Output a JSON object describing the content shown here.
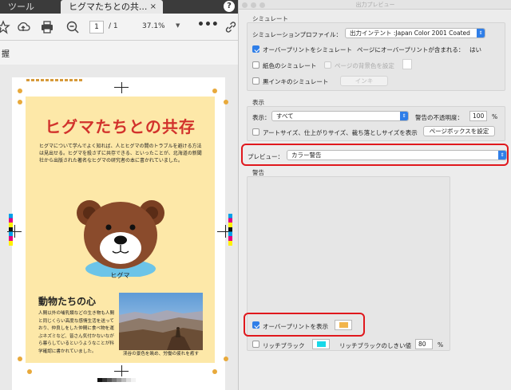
{
  "app": {
    "tools_tab": "ツール",
    "doc_tab": "ヒグマたちとの共...",
    "close_glyph": "×",
    "help_glyph": "?",
    "page_current": "1",
    "page_total": "/ 1",
    "zoom": "37.1%",
    "more_glyph": "•••",
    "subbar_text": "握"
  },
  "document": {
    "title": "ヒグマたちとの共存",
    "intro": "ヒグマについて学んでよく知れば、人とヒグマの間のトラブルを避ける方法は見出せる。ヒグマを殺さずに共存できる、といったことが、北海道の新聞社から出版された著名なヒグマの研究者の本に書かれていました。",
    "bear_caption": "ヒグマ",
    "animals_heading": "動物たちの心",
    "animals_body": "人間以外の哺乳類などの生き物も人間と同じくらい高度な感情生活を送っており、仲良しをした仲間に食べ物を運ぶネズミなど、皆さん気付かないながら暮らしているというようなことが科学確認に書かれていました。",
    "photo_caption": "渓谷の景色を眺め、労働の疲れを癒す",
    "colors": {
      "background": "#fde8a8",
      "title": "#d2322c",
      "bear_brown": "#8a4b2c",
      "bear_muzzle": "#ffffff",
      "collar": "#6cc4e8"
    }
  },
  "dialog": {
    "title": "出力プレビュー",
    "simulate_section": "シミュレート",
    "simulation_profile_label": "シミュレーションプロファイル：",
    "simulation_profile_value": "出力インテント :Japan Color 2001 Coated",
    "simulate_overprint_label": "オーバープリントをシミュレート",
    "page_overprint_label": "ページにオーバープリントが含まれる：",
    "page_overprint_value": "はい",
    "paper_color_label": "紙色のシミュレート",
    "page_bg_label": "ページの背景色を設定",
    "black_ink_label": "黒インキのシミュレート",
    "ink_button": "インキ",
    "display_section": "表示",
    "show_label": "表示：",
    "show_value": "すべて",
    "warning_opacity_label": "警告の不透明度：",
    "warning_opacity_value": "100",
    "percent": "%",
    "artsize_label": "アートサイズ、仕上がりサイズ、裁ち落としサイズを表示",
    "pagebox_button": "ページボックスを設定",
    "preview_label": "プレビュー：",
    "preview_value": "カラー警告",
    "warnings_section": "警告",
    "show_overprint_label": "オーバープリントを表示",
    "rich_black_label": "リッチブラック",
    "rich_black_threshold_label": "リッチブラックのしきい値",
    "rich_black_threshold_value": "80",
    "overprint_swatch_color": "#f2b54c",
    "rich_black_swatch_color": "#18d8e8",
    "highlight_color": "#e0181d"
  }
}
